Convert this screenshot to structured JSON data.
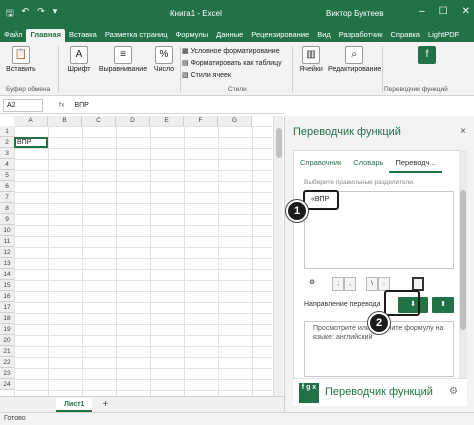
{
  "titlebar": {
    "document_title": "Книга1 - Excel",
    "user_name": "Виктор Буктеев",
    "icons": [
      "save-icon",
      "undo-icon",
      "redo-icon",
      "customize-icon"
    ],
    "window_controls": [
      "minimize-icon",
      "maximize-icon",
      "close-icon"
    ]
  },
  "ribbon_tabs": [
    "Файл",
    "Главная",
    "Вставка",
    "Разметка страниц",
    "Формулы",
    "Данные",
    "Рецензирование",
    "Вид",
    "Разработчик",
    "Справка",
    "LightPDF"
  ],
  "active_tab": "Главная",
  "ribbon": {
    "paste_label": "Вставить",
    "clipboard_label": "Буфер обмена",
    "font_label": "Шрифт",
    "alignment_label": "Выравнивание",
    "number_label": "Число",
    "conditional_formatting": "Условное форматирование",
    "format_as_table": "Форматировать как таблицу",
    "cell_styles": "Стили ячеек",
    "styles_label": "Стили",
    "cells_label": "Ячейки",
    "editing_label": "Редактирование",
    "addin_label": "Переводчик функций"
  },
  "formula_bar": {
    "name_box": "A2",
    "fx_label": "fx",
    "value": "ВПР"
  },
  "sheet": {
    "columns": [
      "A",
      "B",
      "C",
      "D",
      "E",
      "F",
      "G"
    ],
    "rows": [
      "1",
      "2",
      "3",
      "4",
      "5",
      "6",
      "7",
      "8",
      "9",
      "10",
      "11",
      "12",
      "13",
      "14",
      "15",
      "16",
      "17",
      "18",
      "19",
      "20",
      "21",
      "22",
      "23",
      "24"
    ],
    "active_cell_value": "ВПР",
    "sheet_tab": "Лист1",
    "add_sheet": "+"
  },
  "status": "Готово",
  "pane": {
    "title": "Переводчик функций",
    "close": "×",
    "tabs": [
      "Справочник",
      "Словарь",
      "Переводч..."
    ],
    "hint": "Выберите правильные разделители.",
    "input_chip": "«ВПР",
    "separators": [
      ";",
      ",",
      "\\",
      "."
    ],
    "direction_label": "Направление перевода",
    "translate_down": "⬇",
    "translate_up": "⬆",
    "output_text": "Просмотрите или измените формулу на языке: английский",
    "brand_name": "Переводчик функций",
    "brand_logo": "f g x"
  },
  "callouts": [
    "1",
    "2"
  ]
}
